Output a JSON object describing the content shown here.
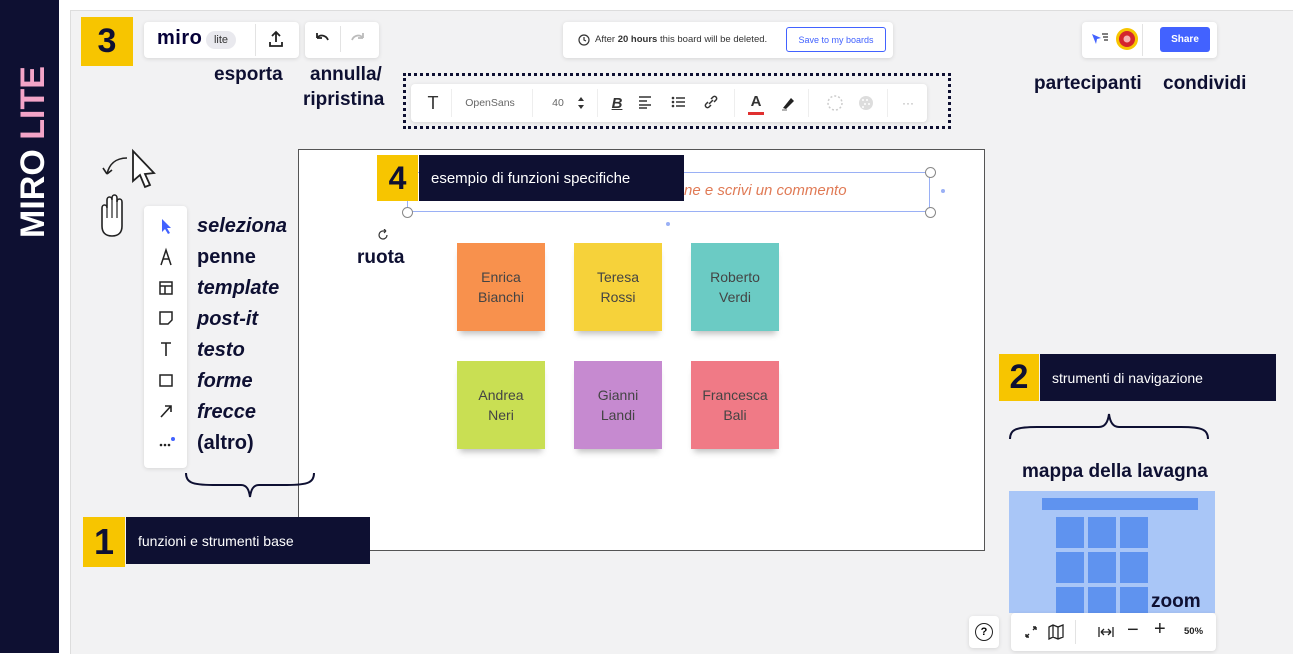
{
  "side_banner": {
    "miro": "MIRO",
    "lite": "LITE"
  },
  "badges": {
    "one": "1",
    "two": "2",
    "three": "3",
    "four": "4"
  },
  "labels": {
    "basic_tools": "funzioni e strumenti base",
    "navigation": "strumenti di navigazione",
    "specific": "esempio di funzioni specifiche"
  },
  "annotations": {
    "export": "esporta",
    "undo_line1": "annulla/",
    "undo_line2": "ripristina",
    "participants": "partecipanti",
    "share": "condividi",
    "rotate": "ruota",
    "board_map": "mappa della lavagna",
    "zoom": "zoom"
  },
  "topbar": {
    "logo": "miro",
    "lite_tag": "lite",
    "notice_prefix": "After",
    "notice_bold": "20 hours",
    "notice_suffix": "this board will be deleted.",
    "save_button": "Save to my boards",
    "share_button": "Share"
  },
  "text_toolbar": {
    "font": "OpenSans",
    "size": "40",
    "bold": "B",
    "text_color_glyph": "A",
    "more": "···"
  },
  "textbox": {
    "text": "ne e scrivi un commento"
  },
  "tool_labels": [
    "seleziona",
    "penne",
    "template",
    "post-it",
    "testo",
    "forme",
    "frecce",
    "(altro)"
  ],
  "tool_icons": [
    "cursor-icon",
    "pen-icon",
    "template-icon",
    "sticky-note-icon",
    "text-icon",
    "shape-icon",
    "arrow-icon",
    "more-icon"
  ],
  "stickies": [
    {
      "name": "Enrica\nBianchi",
      "color": "#f8914d"
    },
    {
      "name": "Teresa\nRossi",
      "color": "#f6d23a"
    },
    {
      "name": "Roberto\nVerdi",
      "color": "#6bcbc4"
    },
    {
      "name": "Andrea\nNeri",
      "color": "#c9df53"
    },
    {
      "name": "Gianni\nLandi",
      "color": "#c68ad0"
    },
    {
      "name": "Francesca\nBali",
      "color": "#f07a86"
    }
  ],
  "zoom_bar": {
    "help": "?",
    "zoom_level": "50%",
    "minus": "−",
    "plus": "+"
  },
  "colors": {
    "navy": "#0e1032",
    "yellow": "#f7c500",
    "accent": "#4262ff",
    "lite_pink": "#f3a4c8",
    "minimap": "#a9c6f7"
  }
}
